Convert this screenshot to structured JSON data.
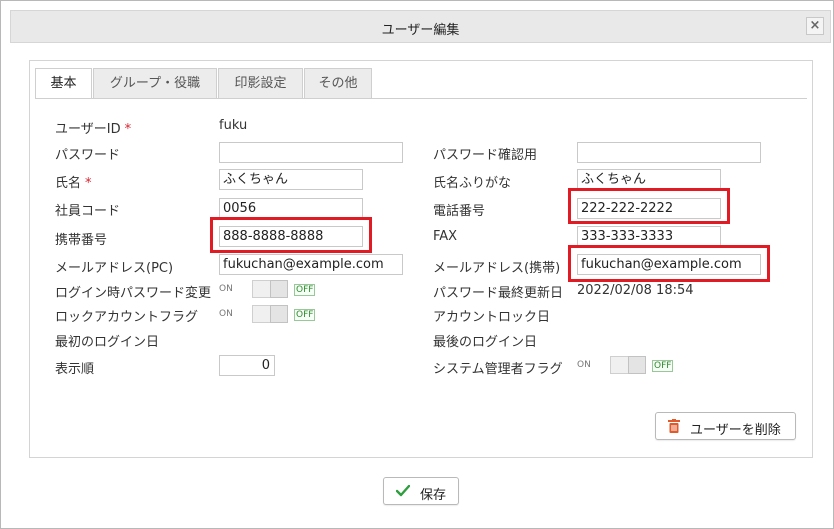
{
  "dialog": {
    "title": "ユーザー編集",
    "close_label": "×"
  },
  "tabs": [
    "基本",
    "グループ・役職",
    "印影設定",
    "その他"
  ],
  "form": {
    "user_id_label": "ユーザーID",
    "user_id_value": "fuku",
    "password_label": "パスワード",
    "password_confirm_label": "パスワード確認用",
    "name_label": "氏名",
    "name_value": "ふくちゃん",
    "name_kana_label": "氏名ふりがな",
    "name_kana_value": "ふくちゃん",
    "employee_code_label": "社員コード",
    "employee_code_value": "0056",
    "phone_label": "電話番号",
    "phone_value": "222-222-2222",
    "mobile_label": "携帯番号",
    "mobile_value": "888-8888-8888",
    "fax_label": "FAX",
    "fax_value": "333-333-3333",
    "email_pc_label": "メールアドレス(PC)",
    "email_pc_value": "fukuchan@example.com",
    "email_mobile_label": "メールアドレス(携帯)",
    "email_mobile_value": "fukuchan@example.com",
    "login_pw_change_label": "ログイン時パスワード変更",
    "pw_last_update_label": "パスワード最終更新日",
    "pw_last_update_value": "2022/02/08 18:54",
    "lock_account_label": "ロックアカウントフラグ",
    "account_lock_date_label": "アカウントロック日",
    "first_login_label": "最初のログイン日",
    "last_login_label": "最後のログイン日",
    "display_order_label": "表示順",
    "display_order_value": "0",
    "sysadmin_label": "システム管理者フラグ",
    "required_mark": "*"
  },
  "toggle": {
    "on_label": "ON",
    "off_label": "OFF"
  },
  "buttons": {
    "delete_user": "ユーザーを削除",
    "save": "保存"
  },
  "colors": {
    "highlight": "#e01b24",
    "required": "#d9232e",
    "save_check": "#2e9e3e",
    "delete_trash": "#e05a2b"
  }
}
